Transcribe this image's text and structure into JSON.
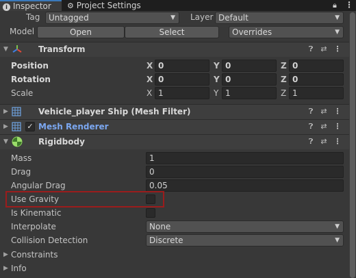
{
  "tabs": [
    {
      "label": "Inspector",
      "icon": "info-icon"
    },
    {
      "label": "Project Settings",
      "icon": "gear-icon"
    }
  ],
  "header": {
    "tag_label": "Tag",
    "tag_value": "Untagged",
    "layer_label": "Layer",
    "layer_value": "Default",
    "model_label": "Model",
    "open_label": "Open",
    "select_label": "Select",
    "overrides_value": "Overrides"
  },
  "transform": {
    "title": "Transform",
    "position": {
      "label": "Position",
      "x": "0",
      "y": "0",
      "z": "0"
    },
    "rotation": {
      "label": "Rotation",
      "x": "0",
      "y": "0",
      "z": "0"
    },
    "scale": {
      "label": "Scale",
      "x": "1",
      "y": "1",
      "z": "1"
    },
    "axis_x": "X",
    "axis_y": "Y",
    "axis_z": "Z"
  },
  "mesh_filter": {
    "title": "Vehicle_player Ship (Mesh Filter)"
  },
  "mesh_renderer": {
    "title": "Mesh Renderer",
    "enabled": true
  },
  "rigidbody": {
    "title": "Rigidbody",
    "mass": {
      "label": "Mass",
      "value": "1"
    },
    "drag": {
      "label": "Drag",
      "value": "0"
    },
    "angular_drag": {
      "label": "Angular Drag",
      "value": "0.05"
    },
    "use_gravity": {
      "label": "Use Gravity",
      "checked": false
    },
    "is_kinematic": {
      "label": "Is Kinematic",
      "checked": false
    },
    "interpolate": {
      "label": "Interpolate",
      "value": "None"
    },
    "collision_detection": {
      "label": "Collision Detection",
      "value": "Discrete"
    },
    "constraints": {
      "label": "Constraints"
    },
    "info": {
      "label": "Info"
    }
  },
  "colors": {
    "highlight_box": "#9b1c1c",
    "link_blue": "#7ba7f0",
    "tab_accent": "#3a79bb"
  }
}
